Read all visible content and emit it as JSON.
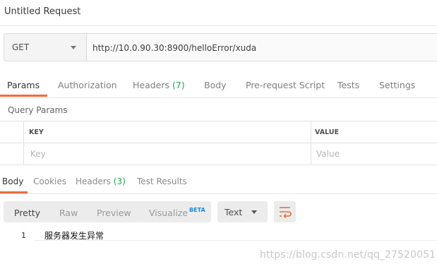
{
  "request": {
    "title": "Untitled Request",
    "method": "GET",
    "url": "http://10.0.90.30:8900/helloError/xuda"
  },
  "request_tabs": [
    {
      "label": "Params",
      "active": true
    },
    {
      "label": "Authorization"
    },
    {
      "label": "Headers",
      "count": "(7)"
    },
    {
      "label": "Body"
    },
    {
      "label": "Pre-request Script"
    },
    {
      "label": "Tests"
    },
    {
      "label": "Settings"
    }
  ],
  "query_params": {
    "title": "Query Params",
    "columns": [
      "KEY",
      "VALUE"
    ],
    "placeholders": {
      "key": "Key",
      "value": "Value"
    }
  },
  "response_tabs": [
    {
      "label": "Body",
      "active": true
    },
    {
      "label": "Cookies"
    },
    {
      "label": "Headers",
      "count": "(3)"
    },
    {
      "label": "Test Results"
    }
  ],
  "view_modes": [
    {
      "label": "Pretty",
      "active": true
    },
    {
      "label": "Raw"
    },
    {
      "label": "Preview"
    },
    {
      "label": "Visualize",
      "badge": "BETA"
    }
  ],
  "format": "Text",
  "response_body": {
    "lines": [
      {
        "number": "1",
        "text": "服务器发生异常"
      }
    ]
  },
  "watermark": "https://blog.csdn.net/qq_27520051",
  "colors": {
    "accent": "#f26b3a",
    "count_green": "#25a35a",
    "beta_blue": "#1a88d8"
  },
  "icons": {
    "method_dropdown": "chevron-down-icon",
    "format_dropdown": "chevron-down-icon",
    "wrap": "wrap-lines-icon"
  }
}
